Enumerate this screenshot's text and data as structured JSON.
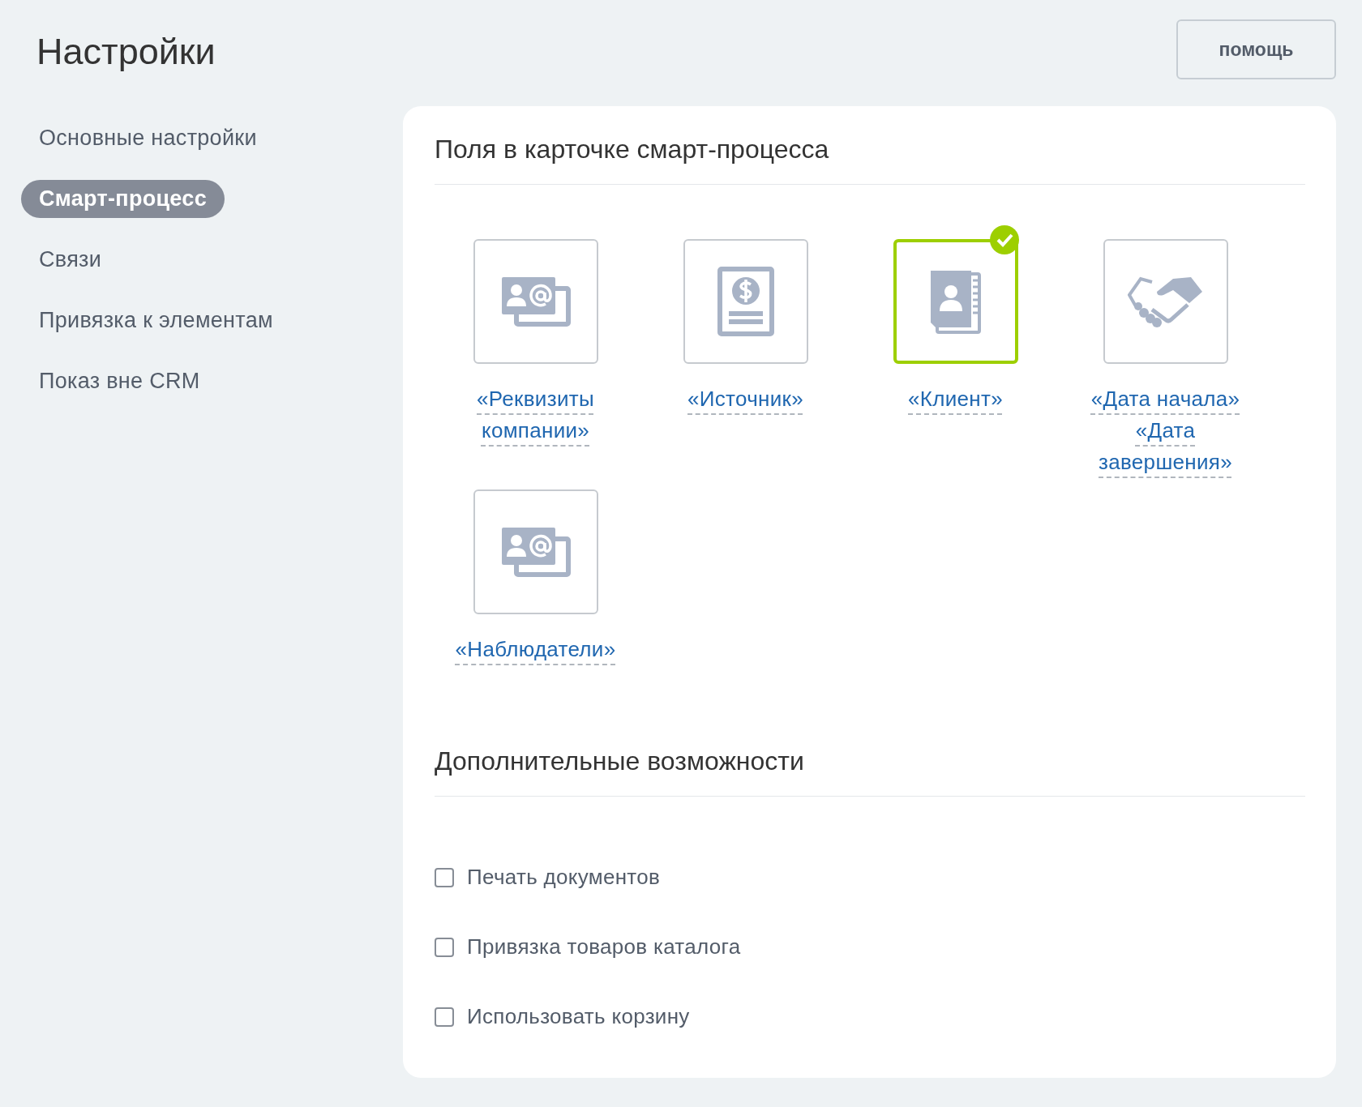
{
  "title": "Настройки",
  "help_button": "помощь",
  "sidebar": {
    "items": [
      {
        "label": "Основные настройки",
        "selected": false
      },
      {
        "label": "Смарт-процесс",
        "selected": true
      },
      {
        "label": "Связи",
        "selected": false
      },
      {
        "label": "Привязка к элементам",
        "selected": false
      },
      {
        "label": "Показ вне CRM",
        "selected": false
      }
    ]
  },
  "fields_section": {
    "title": "Поля в карточке смарт-процесса",
    "fields": [
      {
        "kind": "contact-card",
        "label": "«Реквизиты компании»",
        "selected": false
      },
      {
        "kind": "invoice",
        "label": "«Источник»",
        "selected": false
      },
      {
        "kind": "address-book",
        "label": "«Клиент»",
        "selected": true
      },
      {
        "kind": "handshake",
        "label": "«Дата начала» «Дата завершения»",
        "selected": false
      },
      {
        "kind": "contact-card",
        "label": "«Наблюдатели»",
        "selected": false
      }
    ]
  },
  "extras_section": {
    "title": "Дополнительные возможности",
    "options": [
      {
        "label": "Печать документов",
        "checked": false
      },
      {
        "label": "Привязка товаров каталога",
        "checked": false
      },
      {
        "label": "Использовать корзину",
        "checked": false
      }
    ]
  }
}
